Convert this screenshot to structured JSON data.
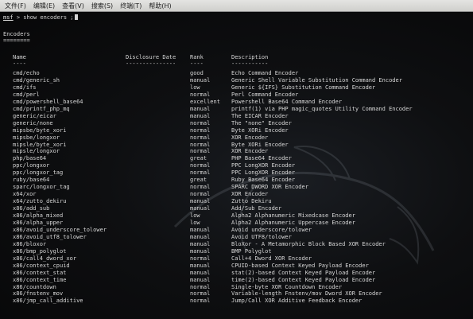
{
  "menubar": {
    "items": [
      "文件(F)",
      "编辑(E)",
      "查看(V)",
      "搜索(S)",
      "终端(T)",
      "帮助(H)"
    ]
  },
  "terminal": {
    "prompt": "msf",
    "command": "> show encoders ;",
    "section_title": "Encoders",
    "section_underline": "========",
    "headers": {
      "name": "Name",
      "disclosure_date": "Disclosure Date",
      "rank": "Rank",
      "description": "Description"
    },
    "header_underlines": {
      "name": "----",
      "disclosure_date": "---------------",
      "rank": "----",
      "description": "-----------"
    },
    "rows": [
      {
        "name": "cmd/echo",
        "rank": "good",
        "description": "Echo Command Encoder"
      },
      {
        "name": "cmd/generic_sh",
        "rank": "manual",
        "description": "Generic Shell Variable Substitution Command Encoder"
      },
      {
        "name": "cmd/ifs",
        "rank": "low",
        "description": "Generic ${IFS} Substitution Command Encoder"
      },
      {
        "name": "cmd/perl",
        "rank": "normal",
        "description": "Perl Command Encoder"
      },
      {
        "name": "cmd/powershell_base64",
        "rank": "excellent",
        "description": "Powershell Base64 Command Encoder"
      },
      {
        "name": "cmd/printf_php_mq",
        "rank": "manual",
        "description": "printf(1) via PHP magic_quotes Utility Command Encoder"
      },
      {
        "name": "generic/eicar",
        "rank": "manual",
        "description": "The EICAR Encoder"
      },
      {
        "name": "generic/none",
        "rank": "normal",
        "description": "The \"none\" Encoder"
      },
      {
        "name": "mipsbe/byte_xori",
        "rank": "normal",
        "description": "Byte XORi Encoder"
      },
      {
        "name": "mipsbe/longxor",
        "rank": "normal",
        "description": "XOR Encoder"
      },
      {
        "name": "mipsle/byte_xori",
        "rank": "normal",
        "description": "Byte XORi Encoder"
      },
      {
        "name": "mipsle/longxor",
        "rank": "normal",
        "description": "XOR Encoder"
      },
      {
        "name": "php/base64",
        "rank": "great",
        "description": "PHP Base64 Encoder"
      },
      {
        "name": "ppc/longxor",
        "rank": "normal",
        "description": "PPC LongXOR Encoder"
      },
      {
        "name": "ppc/longxor_tag",
        "rank": "normal",
        "description": "PPC LongXOR Encoder"
      },
      {
        "name": "ruby/base64",
        "rank": "great",
        "description": "Ruby Base64 Encoder"
      },
      {
        "name": "sparc/longxor_tag",
        "rank": "normal",
        "description": "SPARC DWORD XOR Encoder"
      },
      {
        "name": "x64/xor",
        "rank": "normal",
        "description": "XOR Encoder"
      },
      {
        "name": "x64/zutto_dekiru",
        "rank": "manual",
        "description": "Zutto Dekiru"
      },
      {
        "name": "x86/add_sub",
        "rank": "manual",
        "description": "Add/Sub Encoder"
      },
      {
        "name": "x86/alpha_mixed",
        "rank": "low",
        "description": "Alpha2 Alphanumeric Mixedcase Encoder"
      },
      {
        "name": "x86/alpha_upper",
        "rank": "low",
        "description": "Alpha2 Alphanumeric Uppercase Encoder"
      },
      {
        "name": "x86/avoid_underscore_tolower",
        "rank": "manual",
        "description": "Avoid underscore/tolower"
      },
      {
        "name": "x86/avoid_utf8_tolower",
        "rank": "manual",
        "description": "Avoid UTF8/tolower"
      },
      {
        "name": "x86/bloxor",
        "rank": "manual",
        "description": "BloXor - A Metamorphic Block Based XOR Encoder"
      },
      {
        "name": "x86/bmp_polyglot",
        "rank": "manual",
        "description": "BMP Polyglot"
      },
      {
        "name": "x86/call4_dword_xor",
        "rank": "normal",
        "description": "Call+4 Dword XOR Encoder"
      },
      {
        "name": "x86/context_cpuid",
        "rank": "manual",
        "description": "CPUID-based Context Keyed Payload Encoder"
      },
      {
        "name": "x86/context_stat",
        "rank": "manual",
        "description": "stat(2)-based Context Keyed Payload Encoder"
      },
      {
        "name": "x86/context_time",
        "rank": "manual",
        "description": "time(2)-based Context Keyed Payload Encoder"
      },
      {
        "name": "x86/countdown",
        "rank": "normal",
        "description": "Single-byte XOR Countdown Encoder"
      },
      {
        "name": "x86/fnstenv_mov",
        "rank": "normal",
        "description": "Variable-length Fnstenv/mov Dword XOR Encoder"
      },
      {
        "name": "x86/jmp_call_additive",
        "rank": "normal",
        "description": "Jump/Call XOR Additive Feedback Encoder"
      }
    ]
  },
  "colors": {
    "menubar_bg": "#dcdcda",
    "terminal_bg": "#0b0b0c",
    "terminal_text": "#d6d6d6"
  },
  "icons": {
    "watermark": "kali-dragon-watermark-icon"
  }
}
